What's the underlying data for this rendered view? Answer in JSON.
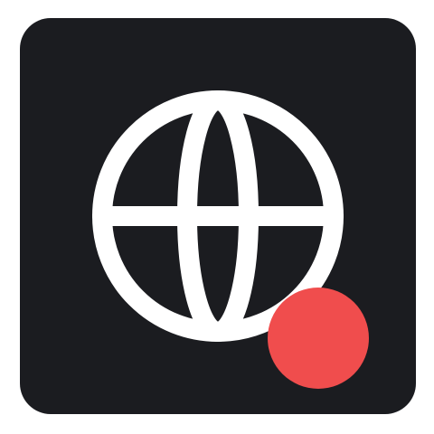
{
  "colors": {
    "page_background": "#ffffff",
    "tile_background": "#1b1c20",
    "globe_stroke": "#ffffff",
    "notification_dot": "#f04d4d"
  },
  "icons": {
    "app_icon": "globe-icon",
    "badge": "notification-dot"
  }
}
